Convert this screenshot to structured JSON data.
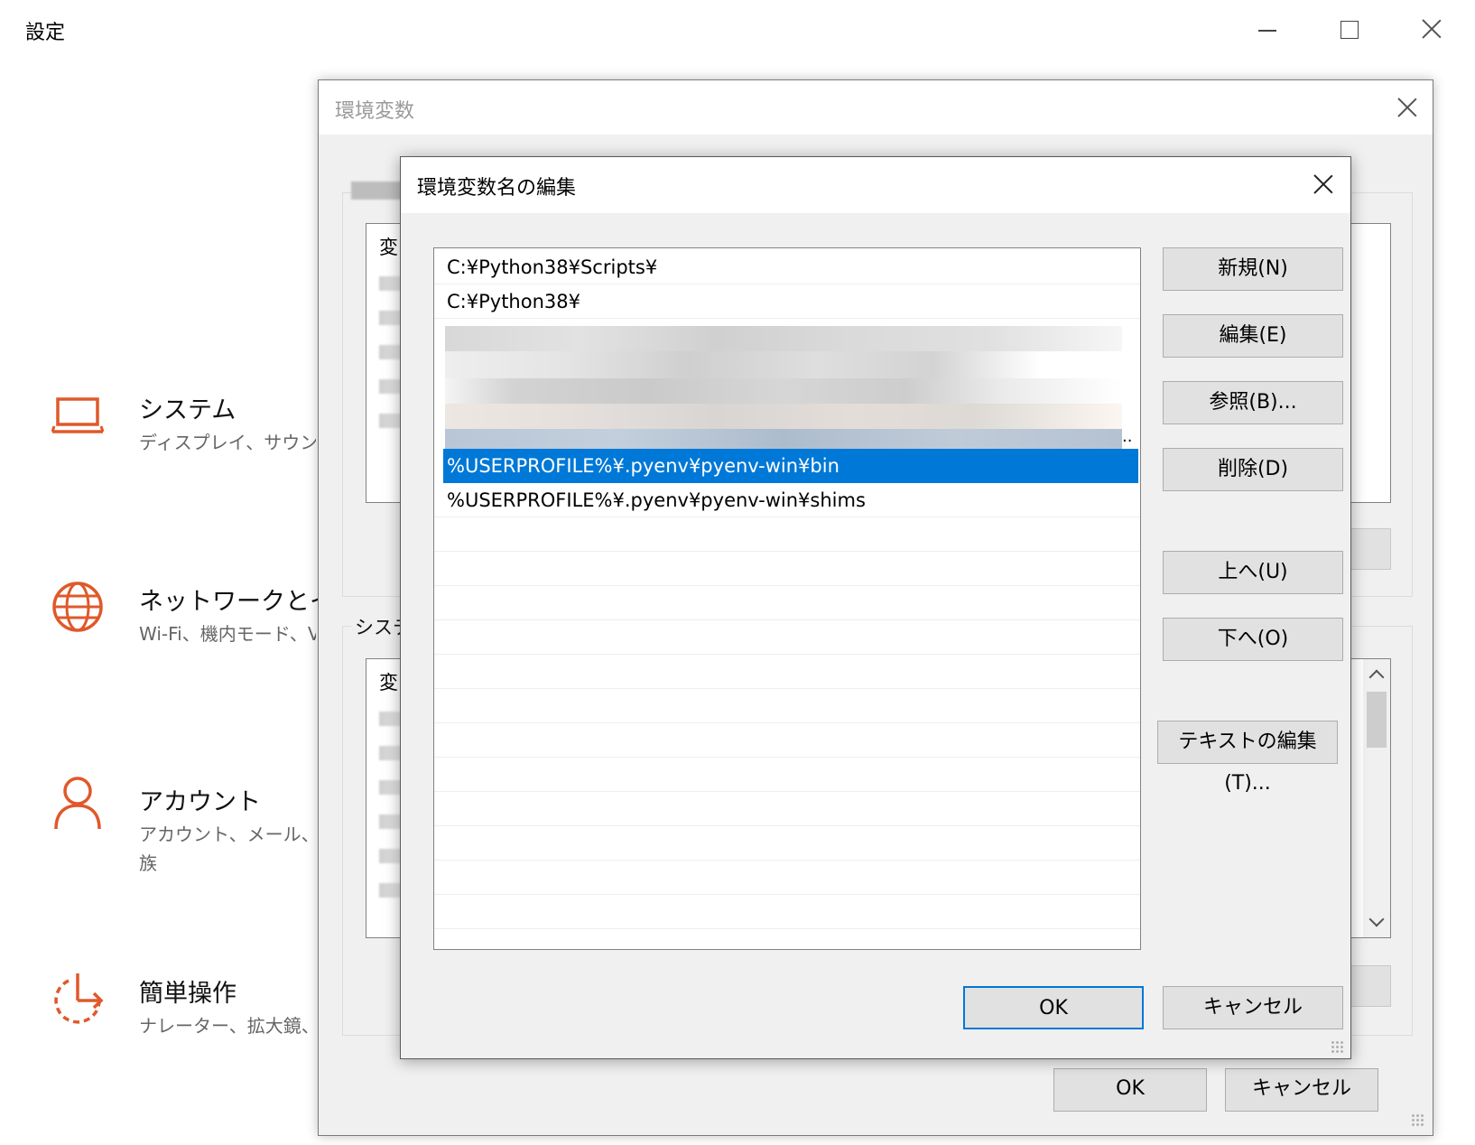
{
  "settings": {
    "title": "設定",
    "categories": [
      {
        "title": "システム",
        "desc": "ディスプレイ、サウンド、",
        "icon": "laptop-icon"
      },
      {
        "title": "ネットワークとイン",
        "desc": "Wi-Fi、機内モード、V",
        "icon": "globe-icon"
      },
      {
        "title": "アカウント",
        "desc": "アカウント、メール、同",
        "desc2": "族",
        "icon": "person-icon"
      },
      {
        "title": "簡単操作",
        "desc": "ナレーター、拡大鏡、ハ",
        "icon": "ease-of-access-icon"
      }
    ],
    "accent_color": "#e0582a"
  },
  "env_dialog": {
    "title": "環境変数",
    "user_group_label": "",
    "user_list_header": "変",
    "system_group_label": "システ",
    "system_list_header": "変",
    "ok_label": "OK",
    "cancel_label": "キャンセル"
  },
  "edit_dialog": {
    "title": "環境変数名の編集",
    "paths": [
      "C:¥Python38¥Scripts¥",
      "C:¥Python38¥",
      "%USERPROFILE%¥.pyenv¥pyenv-win¥bin",
      "%USERPROFILE%¥.pyenv¥pyenv-win¥shims"
    ],
    "selected_index": 2,
    "buttons": {
      "new": "新規(N)",
      "edit": "編集(E)",
      "browse": "参照(B)...",
      "delete": "削除(D)",
      "up": "上へ(U)",
      "down": "下へ(O)",
      "edit_text": "テキストの編集(T)...",
      "ok": "OK",
      "cancel": "キャンセル"
    },
    "truncation": ".."
  },
  "colors": {
    "selection": "#0078d7",
    "dialog_bg": "#f0f0f0"
  }
}
